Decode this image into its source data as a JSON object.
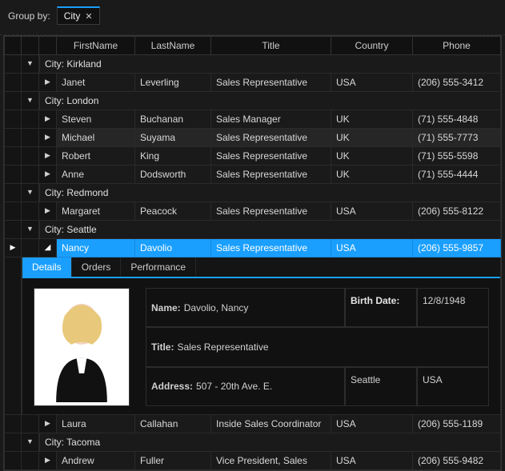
{
  "groupby": {
    "label": "Group by:",
    "chip": "City"
  },
  "columns": [
    "FirstName",
    "LastName",
    "Title",
    "Country",
    "Phone"
  ],
  "groups": [
    {
      "label": "City: Kirkland",
      "expanded": true,
      "rows": [
        {
          "first": "Janet",
          "last": "Leverling",
          "title": "Sales Representative",
          "country": "USA",
          "phone": "(206) 555-3412"
        }
      ]
    },
    {
      "label": "City: London",
      "expanded": true,
      "rows": [
        {
          "first": "Steven",
          "last": "Buchanan",
          "title": "Sales Manager",
          "country": "UK",
          "phone": "(71) 555-4848"
        },
        {
          "first": "Michael",
          "last": "Suyama",
          "title": "Sales Representative",
          "country": "UK",
          "phone": "(71) 555-7773",
          "hover": true
        },
        {
          "first": "Robert",
          "last": "King",
          "title": "Sales Representative",
          "country": "UK",
          "phone": "(71) 555-5598"
        },
        {
          "first": "Anne",
          "last": "Dodsworth",
          "title": "Sales Representative",
          "country": "UK",
          "phone": "(71) 555-4444"
        }
      ]
    },
    {
      "label": "City: Redmond",
      "expanded": true,
      "rows": [
        {
          "first": "Margaret",
          "last": "Peacock",
          "title": "Sales Representative",
          "country": "USA",
          "phone": "(206) 555-8122"
        }
      ]
    },
    {
      "label": "City: Seattle",
      "expanded": true,
      "rows": [
        {
          "first": "Nancy",
          "last": "Davolio",
          "title": "Sales Representative",
          "country": "USA",
          "phone": "(206) 555-9857",
          "selected": true,
          "expanded": true
        },
        {
          "first": "Laura",
          "last": "Callahan",
          "title": "Inside Sales Coordinator",
          "country": "USA",
          "phone": "(206) 555-1189"
        }
      ]
    },
    {
      "label": "City: Tacoma",
      "expanded": true,
      "rows": [
        {
          "first": "Andrew",
          "last": "Fuller",
          "title": "Vice President, Sales",
          "country": "USA",
          "phone": "(206) 555-9482"
        }
      ]
    }
  ],
  "detail": {
    "tabs": [
      "Details",
      "Orders",
      "Performance"
    ],
    "active_tab": 0,
    "name_label": "Name:",
    "name_value": "Davolio, Nancy",
    "birth_label": "Birth Date:",
    "birth_value": "12/8/1948",
    "title_label": "Title:",
    "title_value": "Sales Representative",
    "address_label": "Address:",
    "address_value": "507 - 20th Ave. E.",
    "city_value": "Seattle",
    "country_value": "USA"
  }
}
